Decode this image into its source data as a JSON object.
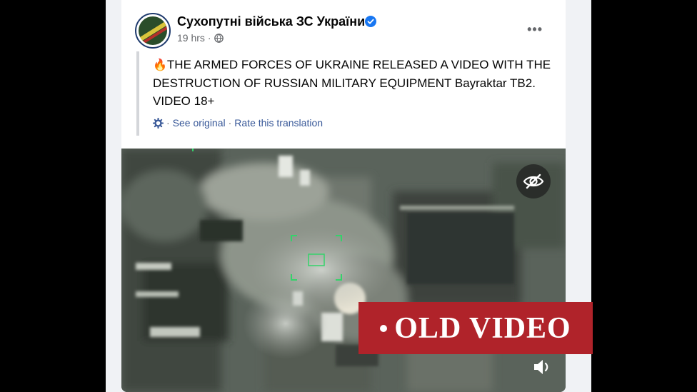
{
  "post": {
    "page_name": "Сухопутні війська ЗС України",
    "time": "19 hrs",
    "separator": "·",
    "more": "•••",
    "fire_emoji": "🔥",
    "text": "THE ARMED FORCES OF UKRAINE RELEASED A VIDEO WITH THE DESTRUCTION OF RUSSIAN MILITARY EQUIPMENT Bayraktar TB2. VIDEO 18+",
    "see_original": "See original",
    "translate_separator": "·",
    "rate_translation": "Rate this translation"
  },
  "stamp": {
    "label": "OLD VIDEO"
  },
  "colors": {
    "stamp": "#b0232a",
    "verified": "#1877f2",
    "link": "#385898"
  },
  "icons": [
    "verified-badge-icon",
    "globe-icon",
    "more-options-icon",
    "gear-icon",
    "hide-eye-icon",
    "volume-icon"
  ]
}
